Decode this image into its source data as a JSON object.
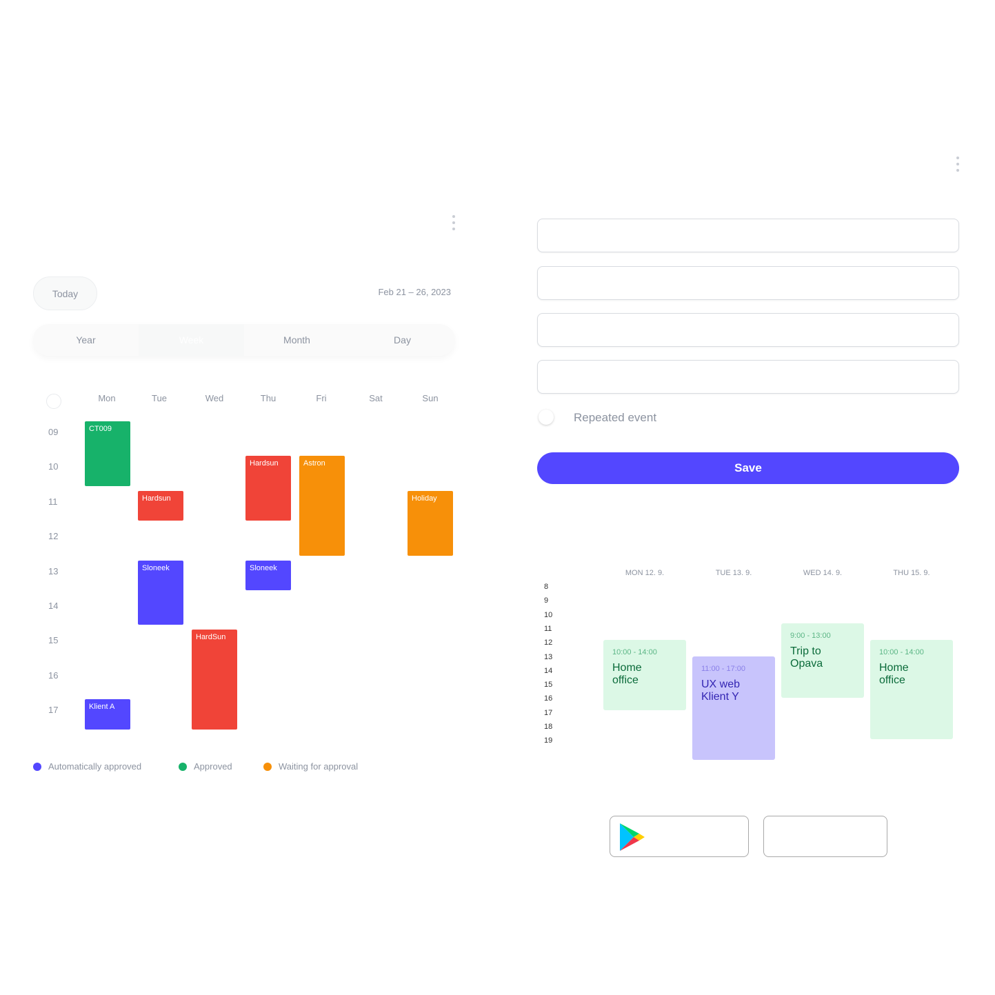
{
  "left": {
    "today_label": "Today",
    "date_range": "Feb 21 – 26, 2023",
    "view_tabs": [
      {
        "label": "Year"
      },
      {
        "label": "Week",
        "active": true
      },
      {
        "label": "Month"
      },
      {
        "label": "Day"
      }
    ],
    "days": [
      "Mon",
      "Tue",
      "Wed",
      "Thu",
      "Fri",
      "Sat",
      "Sun"
    ],
    "hours": [
      "09",
      "10",
      "11",
      "12",
      "13",
      "14",
      "15",
      "16",
      "17"
    ],
    "events": [
      {
        "title": "CT009",
        "day": 0,
        "start": 9,
        "end": 11,
        "status": "approved"
      },
      {
        "title": "Hardsun",
        "day": 1,
        "start": 11,
        "end": 12,
        "status": "rejected"
      },
      {
        "title": "Sloneek",
        "day": 1,
        "start": 13,
        "end": 15,
        "status": "auto"
      },
      {
        "title": "HardSun",
        "day": 2,
        "start": 15,
        "end": 18,
        "status": "rejected"
      },
      {
        "title": "Hardsun",
        "day": 3,
        "start": 10,
        "end": 12,
        "status": "rejected"
      },
      {
        "title": "Sloneek",
        "day": 3,
        "start": 13,
        "end": 14,
        "status": "auto"
      },
      {
        "title": "Astron",
        "day": 4,
        "start": 10,
        "end": 13,
        "status": "waiting"
      },
      {
        "title": "Holiday",
        "day": 6,
        "start": 11,
        "end": 13,
        "status": "waiting"
      },
      {
        "title": "Klient A",
        "day": 0,
        "start": 17,
        "end": 18,
        "status": "auto"
      }
    ],
    "colors": {
      "auto": "#5347ff",
      "approved": "#17b26a",
      "waiting": "#f79009",
      "rejected": "#f04438"
    },
    "legend": [
      {
        "label": "Automatically approved",
        "color": "#5347ff"
      },
      {
        "label": "Approved",
        "color": "#17b26a"
      },
      {
        "label": "Waiting for approval",
        "color": "#f79009"
      }
    ]
  },
  "form": {
    "repeated_label": "Repeated event",
    "repeated_on": false,
    "save_label": "Save"
  },
  "right": {
    "days": [
      "MON 12. 9.",
      "TUE 13. 9.",
      "WED 14. 9.",
      "THU 15. 9."
    ],
    "hours": [
      "8",
      "9",
      "10",
      "11",
      "12",
      "13",
      "14",
      "15",
      "16",
      "17",
      "18",
      "19"
    ],
    "events": [
      {
        "time": "10:00 - 14:00",
        "title": "Home office"
      },
      {
        "time": "11:00 - 17:00",
        "title": "UX web Klient Y"
      },
      {
        "time": "9:00 - 13:00",
        "title": "Trip to Opava"
      },
      {
        "time": "10:00 - 14:00",
        "title": "Home office"
      }
    ]
  },
  "stores": [
    {
      "icon": "google-play-icon"
    },
    {
      "icon": ""
    }
  ]
}
